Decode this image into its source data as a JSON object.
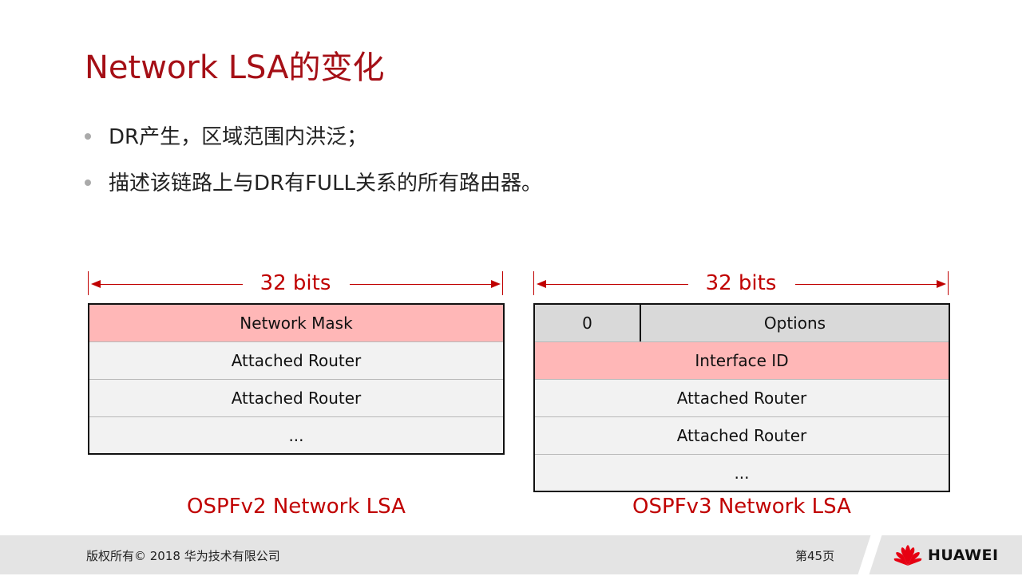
{
  "slide": {
    "title": "Network LSA的变化",
    "bullets": [
      "DR产生，区域范围内洪泛；",
      "描述该链路上与DR有FULL关系的所有路由器。"
    ]
  },
  "diagram_v2": {
    "width_label": "32 bits",
    "rows": [
      "Network Mask",
      "Attached Router",
      "Attached Router",
      "..."
    ],
    "caption": "OSPFv2 Network LSA"
  },
  "diagram_v3": {
    "width_label": "32 bits",
    "header": {
      "zero": "0",
      "options": "Options"
    },
    "rows": [
      "Interface ID",
      "Attached Router",
      "Attached Router",
      "..."
    ],
    "caption": "OSPFv3 Network LSA"
  },
  "footer": {
    "copyright": "版权所有© 2018 华为技术有限公司",
    "page": "第45页",
    "brand": "HUAWEI"
  },
  "colors": {
    "title": "#a50f16",
    "accent_red": "#c00000",
    "highlight_pink": "#ffb7b7",
    "header_gray": "#d9d9d9",
    "row_gray": "#f2f2f2"
  }
}
